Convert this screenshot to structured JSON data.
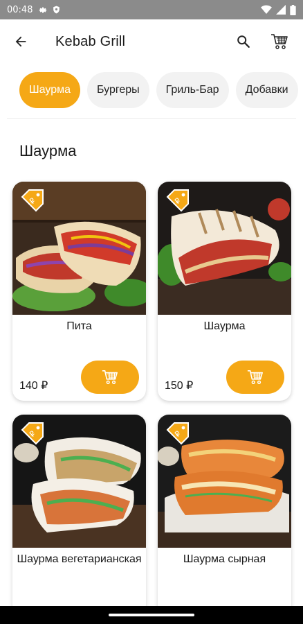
{
  "status_bar": {
    "time": "00:48",
    "icons": [
      "gear-icon",
      "shield-icon",
      "wifi-icon",
      "signal-icon",
      "battery-icon"
    ]
  },
  "app_bar": {
    "title": "Kebab Grill",
    "icons": [
      "back-arrow-icon",
      "search-icon",
      "cart-icon"
    ]
  },
  "categories": [
    {
      "label": "Шаурма",
      "active": true
    },
    {
      "label": "Бургеры",
      "active": false
    },
    {
      "label": "Гриль-Бар",
      "active": false
    },
    {
      "label": "Добавки",
      "active": false
    }
  ],
  "section": {
    "title": "Шаурма"
  },
  "products": [
    {
      "name": "Пита",
      "price": "140 ₽"
    },
    {
      "name": "Шаурма",
      "price": "150 ₽"
    },
    {
      "name": "Шаурма вегетарианская",
      "price": ""
    },
    {
      "name": "Шаурма сырная",
      "price": ""
    }
  ],
  "colors": {
    "accent": "#f5a816",
    "status_bar": "#8b8b8b",
    "chip_inactive": "#f2f2f2"
  }
}
